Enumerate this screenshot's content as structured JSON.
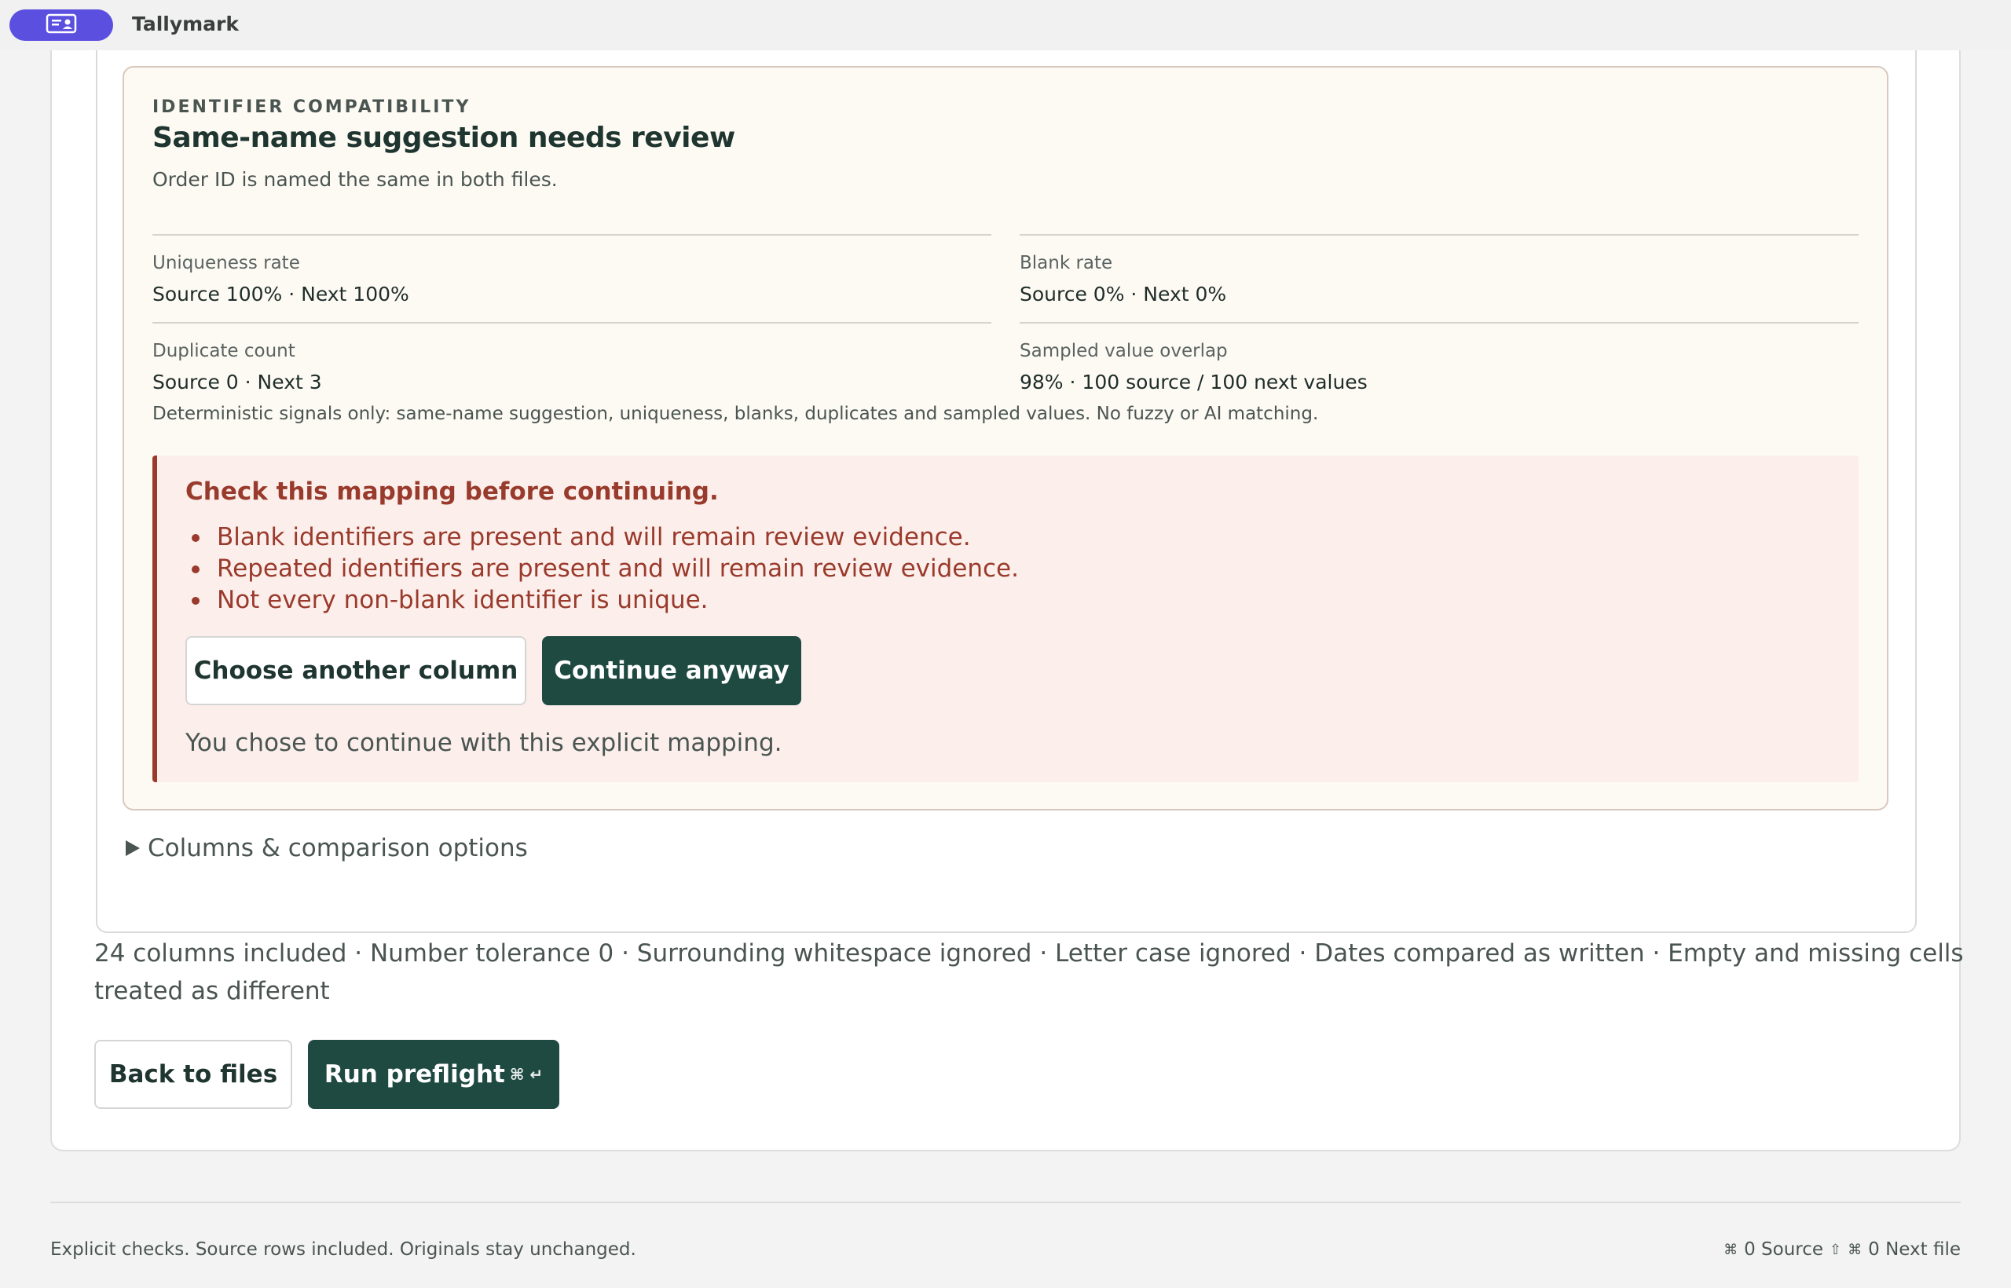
{
  "window": {
    "app_title": "Tallymark",
    "app_icon": "person-card-icon",
    "accent": "#5b4fe0"
  },
  "identifier": {
    "eyebrow": "IDENTIFIER COMPATIBILITY",
    "title": "Same-name suggestion needs review",
    "description": "Order ID is named the same in both files.",
    "metrics": [
      {
        "label": "Uniqueness rate",
        "value": "Source 100% · Next 100%"
      },
      {
        "label": "Blank rate",
        "value": "Source 0% · Next 0%"
      },
      {
        "label": "Duplicate count",
        "value": "Source 0 · Next 3"
      },
      {
        "label": "Sampled value overlap",
        "value": "98% · 100 source / 100 next values"
      }
    ],
    "note": "Deterministic signals only: same-name suggestion, uniqueness, blanks, duplicates and sampled values. No fuzzy or AI matching."
  },
  "warning": {
    "title": "Check this mapping before continuing.",
    "items": [
      "Blank identifiers are present and will remain review evidence.",
      "Repeated identifiers are present and will remain review evidence.",
      "Not every non-blank identifier is unique."
    ],
    "choose_another_label": "Choose another column",
    "continue_label": "Continue anyway",
    "chose_note": "You chose to continue with this explicit mapping.",
    "color": "#9a3a2c"
  },
  "options": {
    "toggle_label": "Columns & comparison options"
  },
  "summary": "24 columns included · Number tolerance 0 · Surrounding whitespace ignored · Letter case ignored · Dates compared as written · Empty and missing cells treated as different",
  "actions": {
    "back_label": "Back to files",
    "run_label": "Run preflight",
    "run_shortcut": "⌘ ↵"
  },
  "footer": {
    "left": "Explicit checks. Source rows included. Originals stay unchanged.",
    "source_key": "⌘",
    "source_label": "0 Source",
    "source_arrow": "⇧",
    "next_key": "⌘",
    "next_label": "0 Next file"
  }
}
